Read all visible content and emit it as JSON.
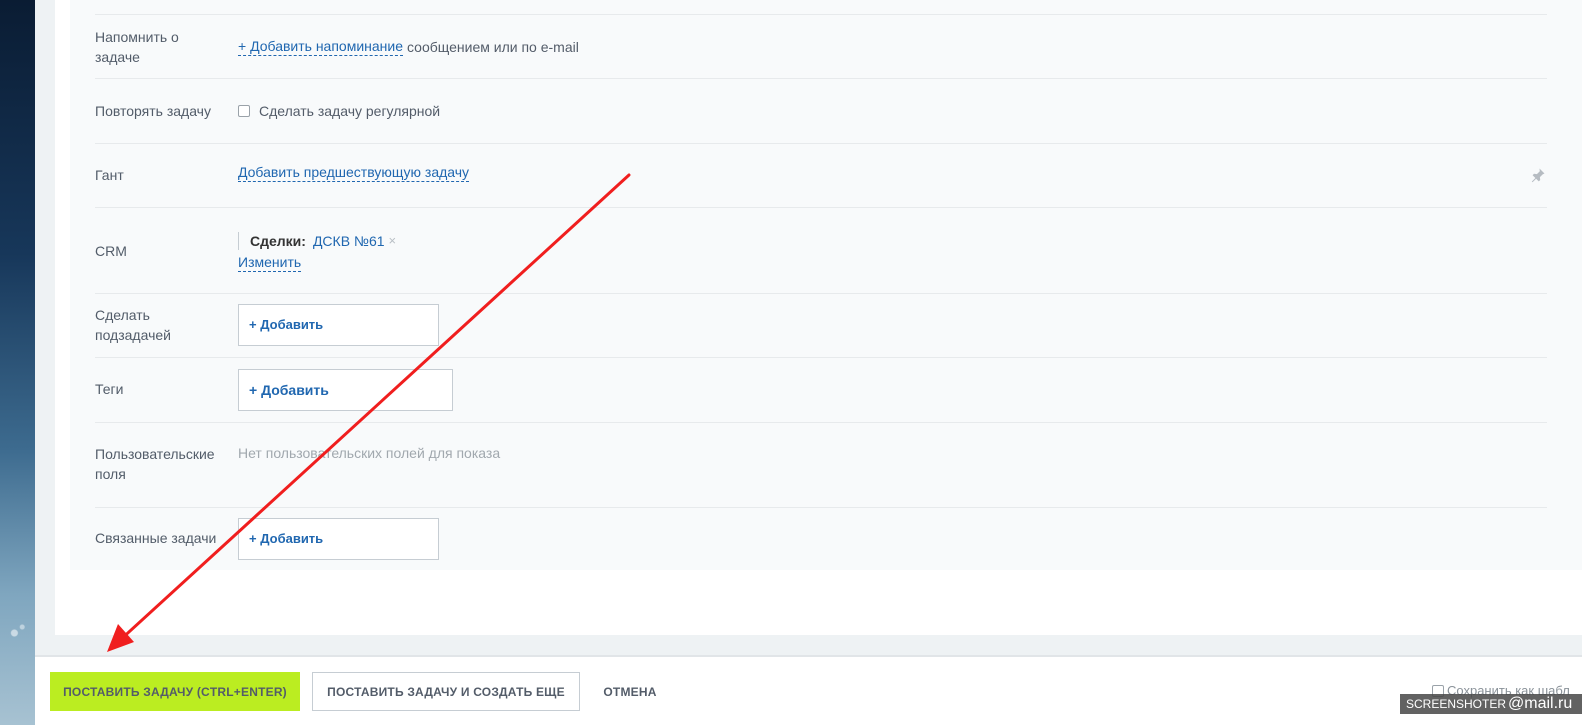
{
  "form": {
    "reminder": {
      "label": "Напомнить о задаче",
      "link": "+ Добавить напоминание",
      "suffix": "сообщением или по e-mail"
    },
    "repeat": {
      "label": "Повторять задачу",
      "checkbox_label": "Сделать задачу регулярной",
      "checked": false
    },
    "gantt": {
      "label": "Гант",
      "link": "Добавить предшествующую задачу",
      "icon": "pin-icon"
    },
    "crm": {
      "label": "CRM",
      "entity_type": "Сделки:",
      "entity_item": "ДСКВ №61",
      "remove_glyph": "×",
      "change_link": "Изменить"
    },
    "subtask": {
      "label": "Сделать подзадачей",
      "add_label": "+ Добавить"
    },
    "tags": {
      "label": "Теги",
      "add_label": "+ Добавить"
    },
    "user_fields": {
      "label": "Пользовательские поля",
      "empty_text": "Нет пользовательских полей для показа"
    },
    "related": {
      "label": "Связанные задачи",
      "add_label": "+ Добавить"
    }
  },
  "footer": {
    "submit_label": "ПОСТАВИТЬ ЗАДАЧУ (CTRL+ENTER)",
    "submit_and_create_label": "ПОСТАВИТЬ ЗАДАЧУ И СОЗДАТЬ ЕЩЕ",
    "cancel_label": "ОТМЕНА",
    "save_template_label": "Сохранить как шабл",
    "save_template_checked": false
  },
  "watermark": {
    "text": "SCREENSHOTER",
    "brand": "@mail.ru"
  },
  "colors": {
    "accent_green": "#bbed21",
    "link_blue": "#2067b0",
    "annotation_arrow": "#f01e1e"
  }
}
